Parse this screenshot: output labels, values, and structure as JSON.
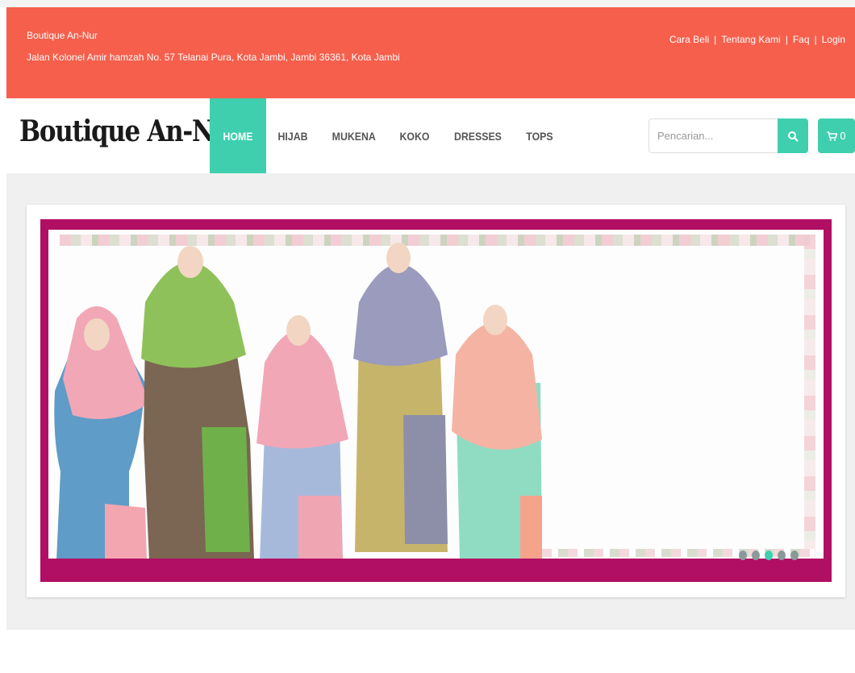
{
  "topbar": {
    "shop_name": "Boutique An-Nur",
    "address": "Jalan Kolonel Amir hamzah No. 57 Telanai Pura, Kota Jambi, Jambi 36361, Kota Jambi",
    "links": [
      "Cara Beli",
      "Tentang Kami",
      "Faq",
      "Login"
    ],
    "separator": "|",
    "color": "#f65f4c"
  },
  "navbar": {
    "brand": "Boutique An-Nur",
    "menu": [
      "HOME",
      "HIJAB",
      "MUKENA",
      "KOKO",
      "DRESSES",
      "TOPS"
    ],
    "active_index": 0,
    "accent": "#3fcfae"
  },
  "search": {
    "placeholder": "Pencarian...",
    "button_icon": "search-icon"
  },
  "cart": {
    "icon": "shopping-cart-icon",
    "count": "0"
  },
  "slider": {
    "border_color": "#b10f63",
    "slide_count": 5,
    "active_slide": 2
  }
}
